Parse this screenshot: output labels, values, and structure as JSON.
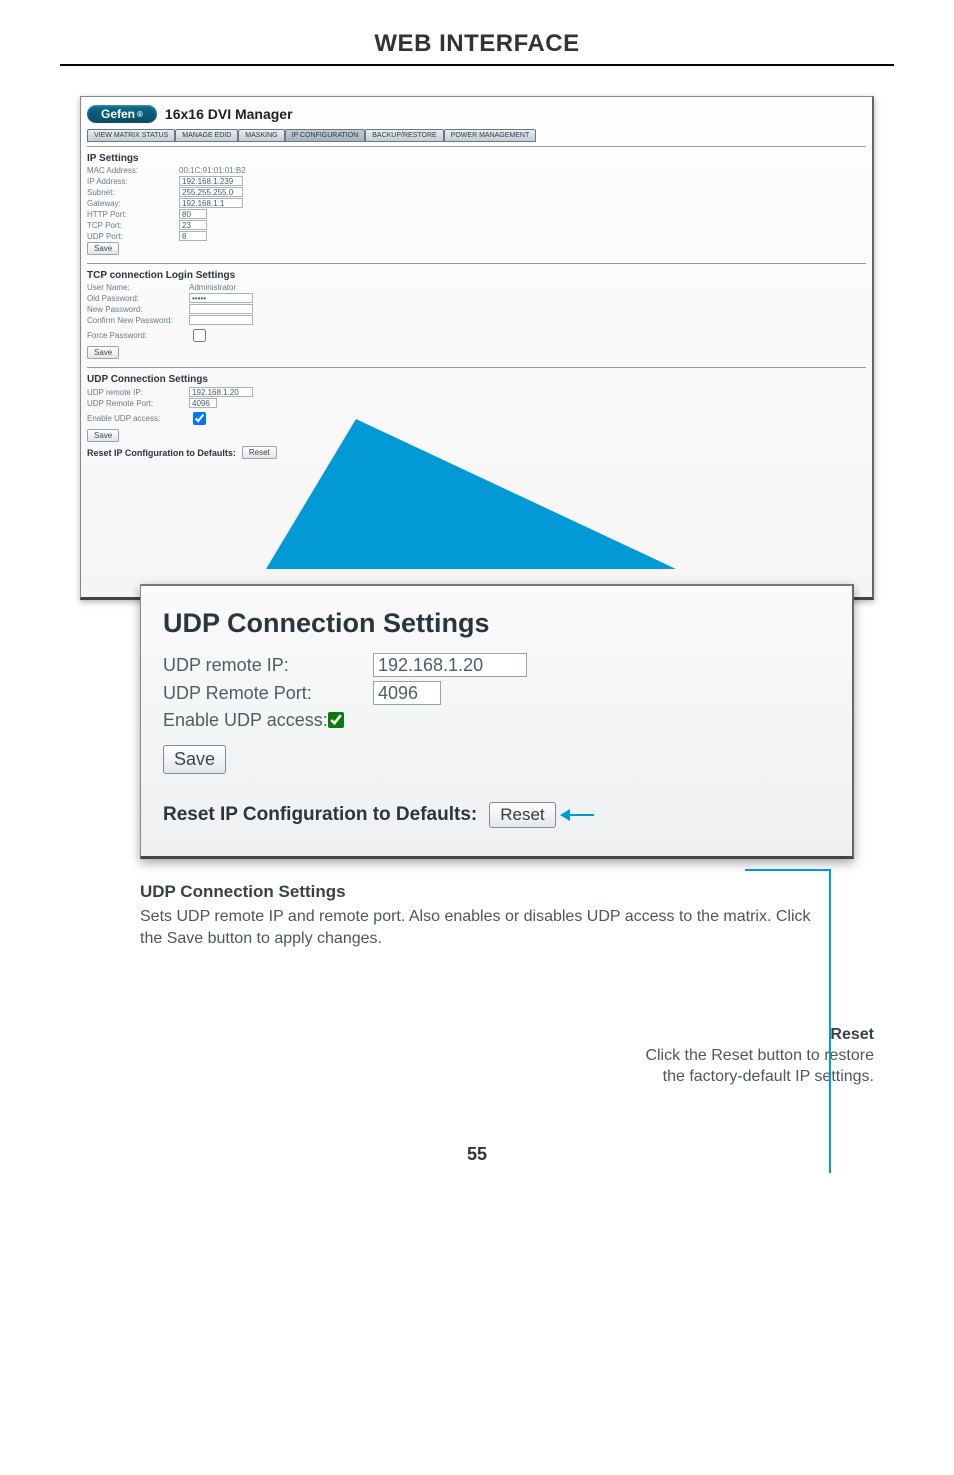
{
  "header": {
    "title": "WEB INTERFACE"
  },
  "shot": {
    "brand": "Gefen",
    "brand_reg": "®",
    "product": "16x16 DVI Manager",
    "tabs": [
      {
        "label": "VIEW MATRIX STATUS",
        "active": false
      },
      {
        "label": "MANAGE EDID",
        "active": false
      },
      {
        "label": "MASKING",
        "active": false
      },
      {
        "label": "IP CONFIGURATION",
        "active": true
      },
      {
        "label": "BACKUP/RESTORE",
        "active": false
      },
      {
        "label": "POWER MANAGEMENT",
        "active": false
      }
    ],
    "ip_settings": {
      "heading": "IP Settings",
      "mac_label": "MAC Address:",
      "mac_value": "00:1C:91:01:01:B2",
      "ip_label": "IP Address:",
      "ip_value": "192.168.1.239",
      "subnet_label": "Subnet:",
      "subnet_value": "255.255.255.0",
      "gw_label": "Gateway:",
      "gw_value": "192.168.1.1",
      "http_label": "HTTP Port:",
      "http_value": "80",
      "tcp_label": "TCP Port:",
      "tcp_value": "23",
      "udp_label": "UDP Port:",
      "udp_value": "8",
      "save_label": "Save"
    },
    "tcp_login": {
      "heading": "TCP connection Login Settings",
      "user_label": "User Name:",
      "user_value": "Administrator",
      "oldpw_label": "Old Password:",
      "oldpw_value": "•••••",
      "newpw_label": "New Password:",
      "confpw_label": "Confirm New Password:",
      "force_label": "Force Password:",
      "save_label": "Save"
    },
    "udp": {
      "heading": "UDP Connection Settings",
      "remote_ip_label": "UDP remote IP:",
      "remote_ip_value": "192.168.1.20",
      "remote_port_label": "UDP Remote Port:",
      "remote_port_value": "4096",
      "enable_label": "Enable UDP access:",
      "save_label": "Save"
    },
    "reset_row": {
      "label": "Reset IP Configuration to Defaults:",
      "button": "Reset"
    }
  },
  "zoom": {
    "heading": "UDP Connection Settings",
    "remote_ip_label": "UDP remote IP:",
    "remote_ip_value": "192.168.1.20",
    "remote_port_label": "UDP Remote Port:",
    "remote_port_value": "4096",
    "enable_label": "Enable UDP access:",
    "save_label": "Save",
    "reset_label": "Reset IP Configuration to Defaults:",
    "reset_button": "Reset"
  },
  "caption": {
    "heading": "UDP Connection Settings",
    "body": "Sets UDP remote IP and remote port.  Also enables or disables UDP access to the matrix.  Click the Save button to apply changes."
  },
  "reset_caption": {
    "heading": "Reset",
    "body1": "Click the Reset button to restore",
    "body2": "the factory-default IP settings."
  },
  "pagenum": "55"
}
